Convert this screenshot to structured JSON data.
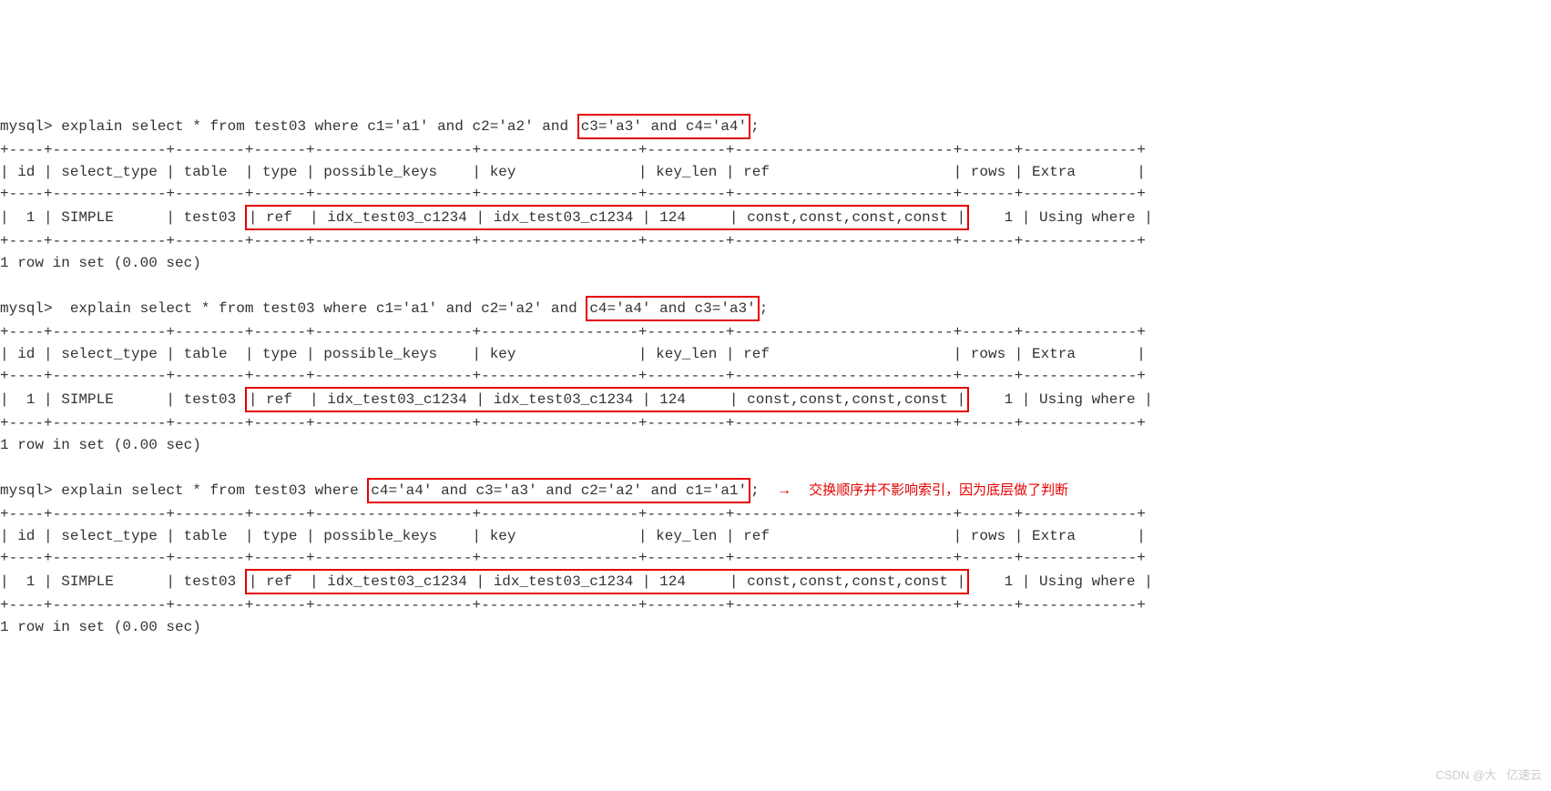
{
  "prompt": "mysql>",
  "q1": {
    "cmd_pre": " explain select * from test03 where c1='a1' and c2='a2' and ",
    "cmd_box": "c3='a3' and c4='a4'",
    "cmd_post": ";"
  },
  "q2": {
    "cmd_pre": "  explain select * from test03 where c1='a1' and c2='a2' and ",
    "cmd_box": "c4='a4' and c3='a3'",
    "cmd_post": ";"
  },
  "q3": {
    "cmd_pre": " explain select * from test03 where ",
    "cmd_box": "c4='a4' and c3='a3' and c2='a2' and c1='a1'",
    "cmd_post": ";",
    "arrow": "→",
    "anno": "交换顺序并不影响索引，因为底层做了判断"
  },
  "table": {
    "top": "+----+-------------+--------+------+------------------+------------------+---------+-------------------------+------+-------------+",
    "header": "| id | select_type | table  | type | possible_keys    | key              | key_len | ref                     | rows | Extra       |",
    "row_pre": "|  1 | SIMPLE      | test03 ",
    "row_boxed": "| ref  | idx_test03_c1234 | idx_test03_c1234 | 124     | const,const,const,const |",
    "row_post": "    1 | Using where |"
  },
  "footer": "1 row in set (0.00 sec)",
  "watermark": "CSDN @大   亿速云",
  "chart_data": {
    "type": "table",
    "columns": [
      "id",
      "select_type",
      "table",
      "type",
      "possible_keys",
      "key",
      "key_len",
      "ref",
      "rows",
      "Extra"
    ],
    "rows": [
      [
        1,
        "SIMPLE",
        "test03",
        "ref",
        "idx_test03_c1234",
        "idx_test03_c1234",
        124,
        "const,const,const,const",
        1,
        "Using where"
      ],
      [
        1,
        "SIMPLE",
        "test03",
        "ref",
        "idx_test03_c1234",
        "idx_test03_c1234",
        124,
        "const,const,const,const",
        1,
        "Using where"
      ],
      [
        1,
        "SIMPLE",
        "test03",
        "ref",
        "idx_test03_c1234",
        "idx_test03_c1234",
        124,
        "const,const,const,const",
        1,
        "Using where"
      ]
    ]
  }
}
